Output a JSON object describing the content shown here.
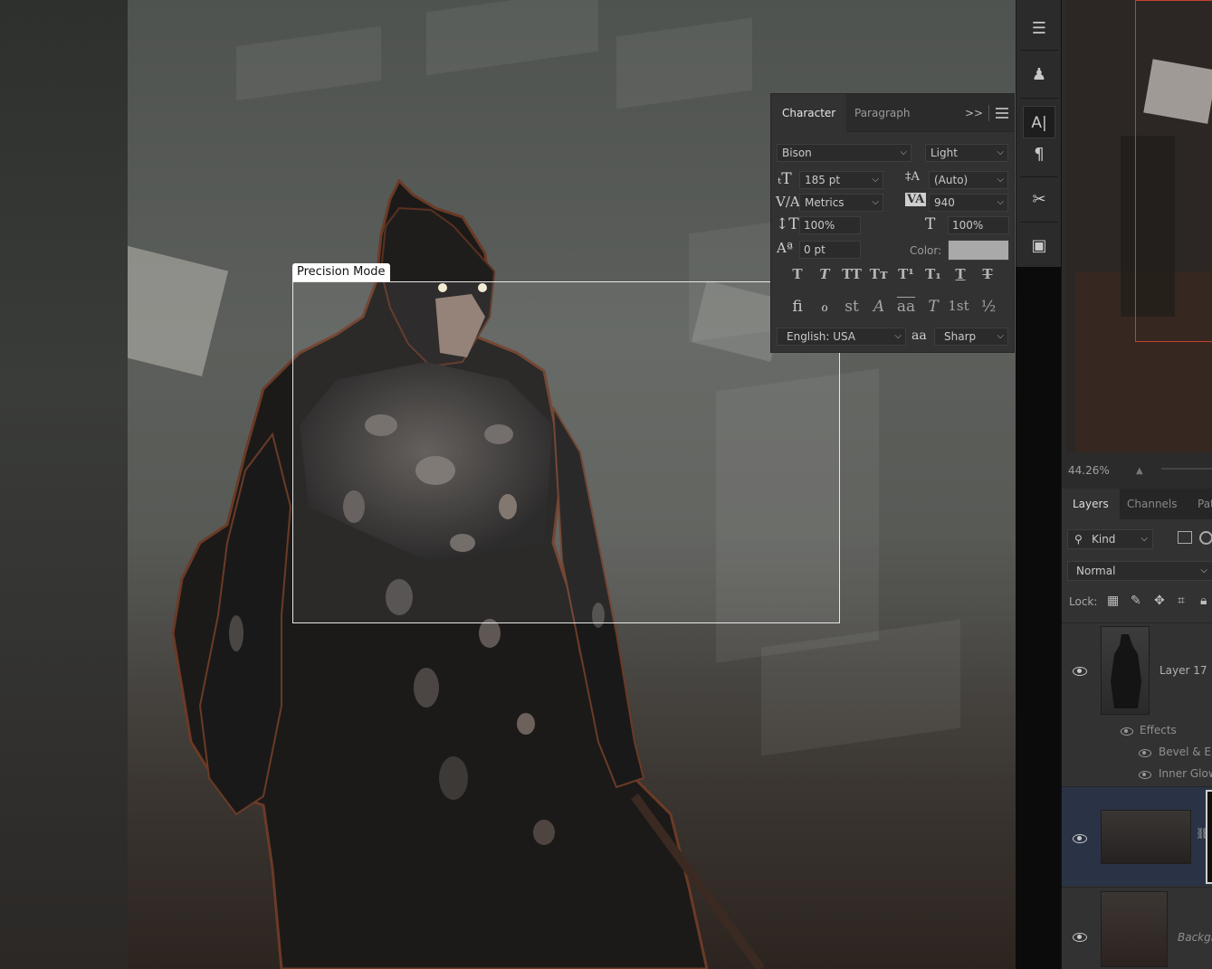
{
  "canvas": {
    "selection_label": "Precision Mode"
  },
  "character_panel": {
    "tabs": [
      "Character",
      "Paragraph"
    ],
    "expand_glyph": ">>",
    "font_family": "Bison",
    "font_style": "Light",
    "font_size": "185 pt",
    "leading": "(Auto)",
    "kerning": "Metrics",
    "tracking": "940",
    "vertical_scale": "100%",
    "horizontal_scale": "100%",
    "baseline_shift": "0 pt",
    "color_label": "Color:",
    "color_value": "#a9a9a9",
    "language": "English: USA",
    "aa_glyph": "aa",
    "antialias": "Sharp",
    "type_styles": [
      "T",
      "T",
      "TT",
      "Tт",
      "T¹",
      "T₁",
      "T",
      "T"
    ],
    "opentype": [
      "fi",
      "ℴ",
      "st",
      "A",
      "aa",
      "T",
      "1st",
      "½"
    ]
  },
  "toolstrip": {
    "icons": [
      "brush-presets-icon",
      "clone-source-icon",
      "character-panel-icon",
      "paragraph-icon",
      "tool-presets-icon",
      "libraries-icon"
    ]
  },
  "navigator": {
    "zoom": "44.26%"
  },
  "layers_panel": {
    "tabs": [
      "Layers",
      "Channels",
      "Pat"
    ],
    "filter_kind": "Kind",
    "blend_mode": "Normal",
    "lock_label": "Lock:",
    "layers": [
      {
        "name": "Layer 17",
        "effects_label": "Effects",
        "effects": [
          "Bevel & Em",
          "Inner Glow"
        ]
      },
      {
        "name": ""
      },
      {
        "name": "Backgr"
      }
    ]
  },
  "colors": {
    "selection_border": "#e8e8e8",
    "navigator_frame": "#c8402e",
    "selected_layer": "#2a3345"
  }
}
